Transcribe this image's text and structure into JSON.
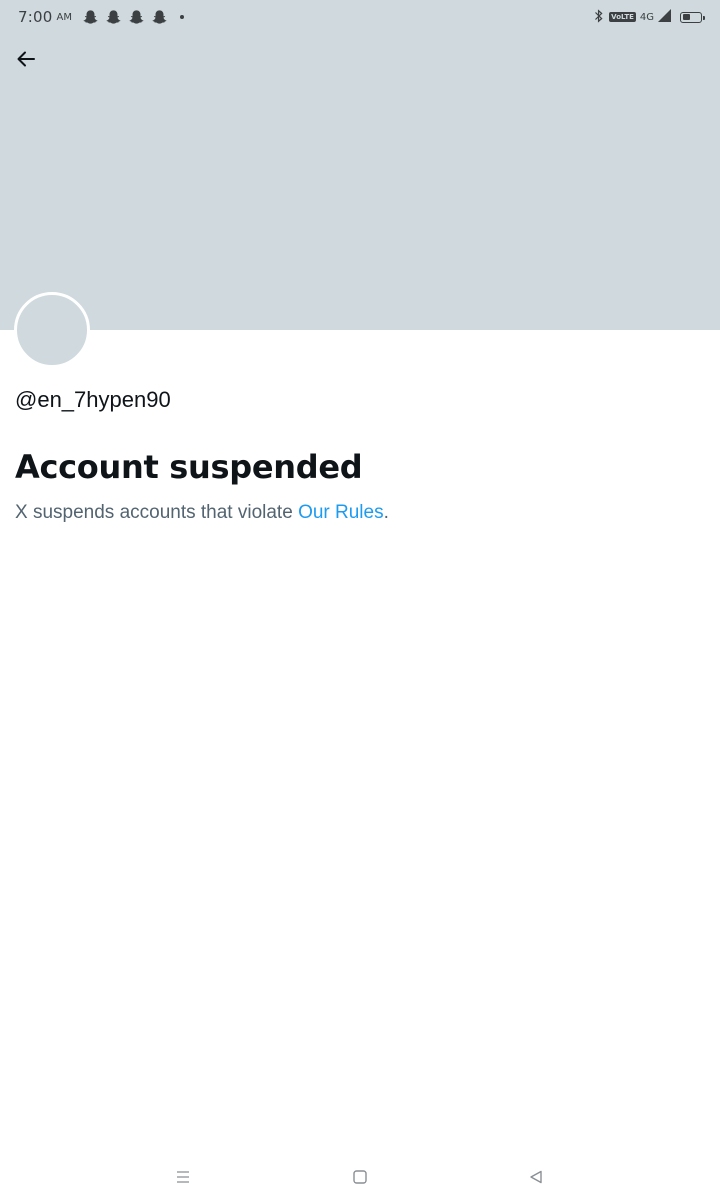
{
  "status_bar": {
    "time": "7:00",
    "time_suffix": "AM",
    "notifications": [
      "snapchat-icon",
      "snapchat-icon",
      "snapchat-icon",
      "snapchat-icon"
    ],
    "volte_label": "VoLTE",
    "network_label": "4G",
    "battery_level": 0.35
  },
  "header": {
    "back_icon": "arrow-left-icon"
  },
  "profile": {
    "handle": "@en_7hypen90",
    "title": "Account suspended",
    "description_prefix": "X suspends accounts that violate ",
    "rules_link_label": "Our Rules",
    "description_suffix": "."
  },
  "nav_bar": {
    "recents_icon": "menu-icon",
    "home_icon": "square-icon",
    "back_icon": "triangle-back-icon"
  },
  "colors": {
    "banner": "#cfd9de",
    "text_primary": "#0f1419",
    "text_secondary": "#536471",
    "link": "#1d9bf0"
  }
}
